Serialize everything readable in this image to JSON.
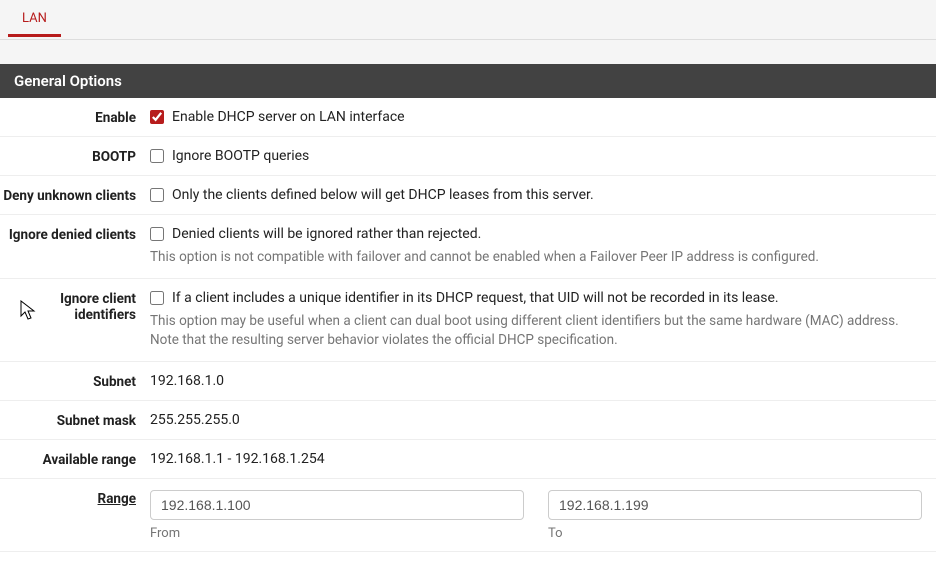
{
  "tabs": {
    "lan": "LAN"
  },
  "section_title": "General Options",
  "rows": {
    "enable": {
      "label": "Enable",
      "checkbox_label": "Enable DHCP server on LAN interface",
      "checked": true
    },
    "bootp": {
      "label": "BOOTP",
      "checkbox_label": "Ignore BOOTP queries",
      "checked": false
    },
    "deny_unknown": {
      "label": "Deny unknown clients",
      "checkbox_label": "Only the clients defined below will get DHCP leases from this server.",
      "checked": false
    },
    "ignore_denied": {
      "label": "Ignore denied clients",
      "checkbox_label": "Denied clients will be ignored rather than rejected.",
      "checked": false,
      "help": "This option is not compatible with failover and cannot be enabled when a Failover Peer IP address is configured."
    },
    "ignore_client_ids": {
      "label": "Ignore client identifiers",
      "checkbox_label": "If a client includes a unique identifier in its DHCP request, that UID will not be recorded in its lease.",
      "checked": false,
      "help": "This option may be useful when a client can dual boot using different client identifiers but the same hardware (MAC) address. Note that the resulting server behavior violates the official DHCP specification."
    },
    "subnet": {
      "label": "Subnet",
      "value": "192.168.1.0"
    },
    "subnet_mask": {
      "label": "Subnet mask",
      "value": "255.255.255.0"
    },
    "available_range": {
      "label": "Available range",
      "value": "192.168.1.1 - 192.168.1.254"
    },
    "range": {
      "label": "Range",
      "from_value": "192.168.1.100",
      "from_sublabel": "From",
      "to_value": "192.168.1.199",
      "to_sublabel": "To"
    }
  }
}
